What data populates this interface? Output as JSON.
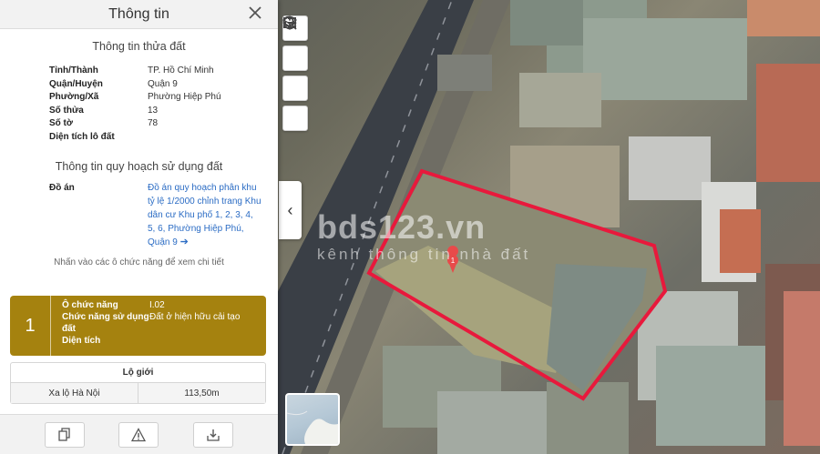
{
  "panel": {
    "title": "Thông tin",
    "land_info": {
      "title": "Thông tin thửa đất",
      "rows": [
        {
          "key": "Tỉnh/Thành",
          "value": "TP. Hồ Chí Minh"
        },
        {
          "key": "Quận/Huyện",
          "value": "Quận 9"
        },
        {
          "key": "Phường/Xã",
          "value": "Phường Hiệp Phú"
        },
        {
          "key": "Số thửa",
          "value": "13"
        },
        {
          "key": "Số tờ",
          "value": "78"
        },
        {
          "key": "Diện tích lô đất",
          "value": ""
        }
      ]
    },
    "planning": {
      "title": "Thông tin quy hoạch sử dụng đất",
      "key": "Đồ án",
      "link": "Đồ án quy hoạch phân khu tỷ lệ 1/2000 chỉnh trang Khu dân cư Khu phố 1, 2, 3, 4, 5, 6, Phường Hiệp Phú, Quận 9",
      "arrow": "➔"
    },
    "hint": "Nhấn vào các ô chức năng để xem chi tiết",
    "lot": {
      "number": "1",
      "rows": [
        {
          "key": "Ô chức năng",
          "value": "I.02"
        },
        {
          "key": "Chức năng sử dụng đất",
          "value": "Đất ở hiện hữu cải tạo"
        },
        {
          "key": "Diện tích",
          "value": ""
        }
      ]
    },
    "lo_gioi": {
      "title": "Lộ giới",
      "road": "Xa lộ Hà Nội",
      "width": "113,50m"
    }
  },
  "map": {
    "marker_label": "1",
    "watermark_title": "bds123.vn",
    "watermark_sub": "kênh thông tin nhà đất",
    "collapse_glyph": "‹",
    "boundary_color": "#e8193c"
  }
}
